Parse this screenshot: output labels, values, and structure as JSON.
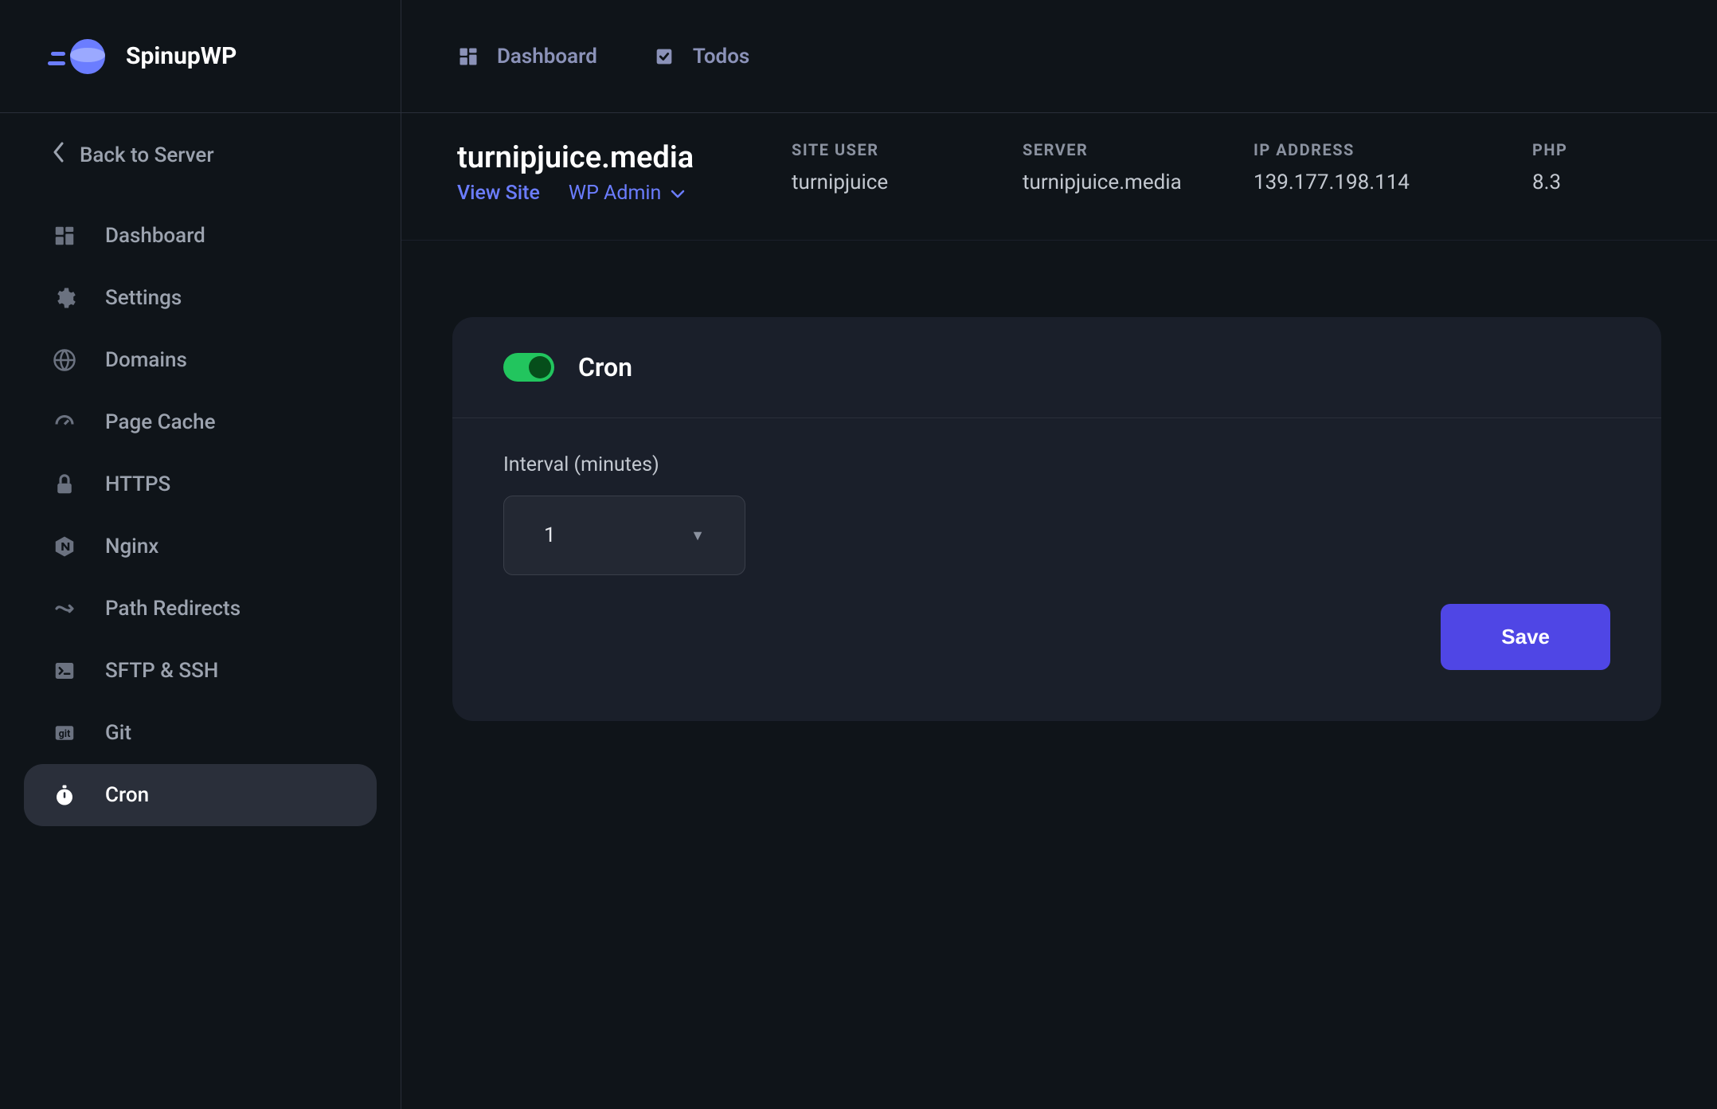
{
  "brand": {
    "name": "SpinupWP"
  },
  "topbar": {
    "dashboard": "Dashboard",
    "todos": "Todos"
  },
  "sidebar": {
    "back": "Back to Server",
    "items": [
      {
        "label": "Dashboard"
      },
      {
        "label": "Settings"
      },
      {
        "label": "Domains"
      },
      {
        "label": "Page Cache"
      },
      {
        "label": "HTTPS"
      },
      {
        "label": "Nginx"
      },
      {
        "label": "Path Redirects"
      },
      {
        "label": "SFTP & SSH"
      },
      {
        "label": "Git"
      },
      {
        "label": "Cron"
      }
    ]
  },
  "site": {
    "title": "turnipjuice.media",
    "view_site": "View Site",
    "wp_admin": "WP Admin",
    "info": {
      "site_user_label": "SITE USER",
      "site_user_value": "turnipjuice",
      "server_label": "SERVER",
      "server_value": "turnipjuice.media",
      "ip_label": "IP ADDRESS",
      "ip_value": "139.177.198.114",
      "php_label": "PHP",
      "php_value": "8.3"
    }
  },
  "cron": {
    "title": "Cron",
    "enabled": true,
    "interval_label": "Interval (minutes)",
    "interval_value": "1",
    "save": "Save"
  }
}
